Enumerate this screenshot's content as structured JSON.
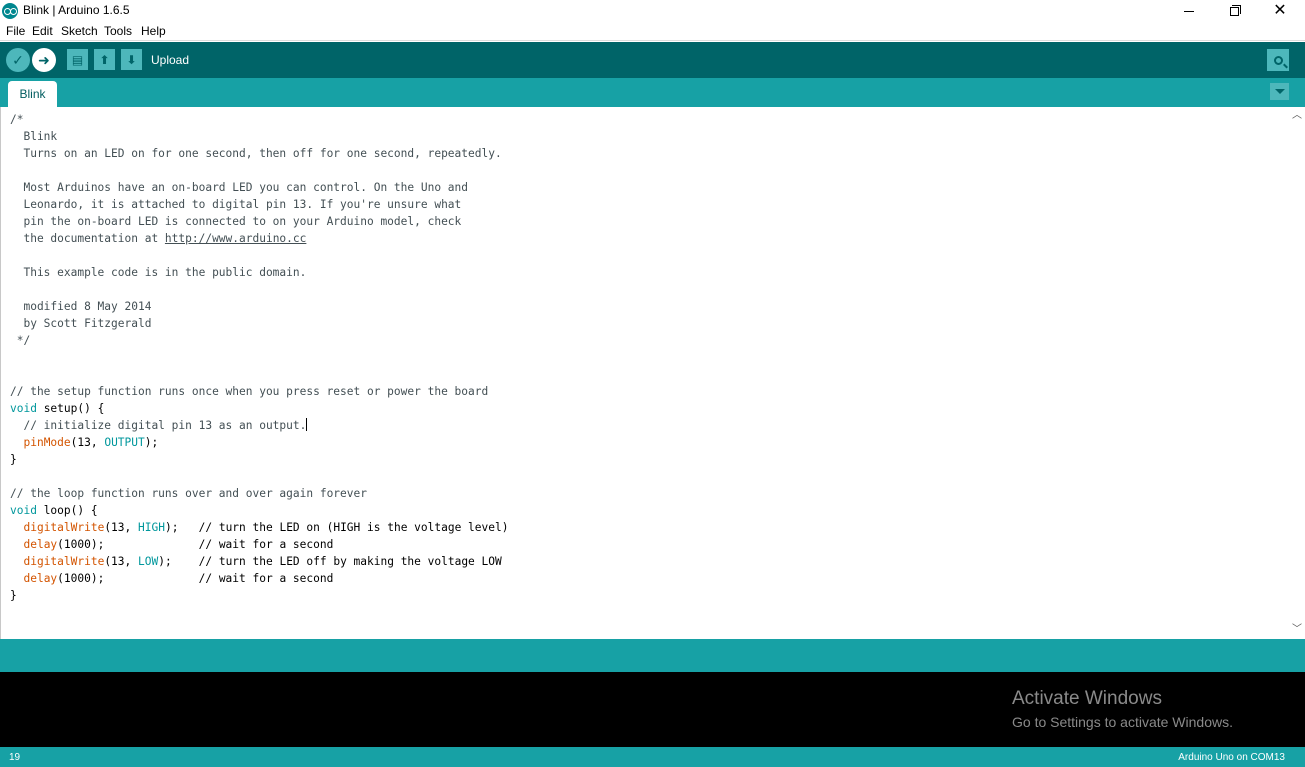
{
  "window": {
    "title": "Blink | Arduino 1.6.5",
    "minimize": "",
    "close": "✕"
  },
  "menu": [
    "File",
    "Edit",
    "Sketch",
    "Tools",
    "Help"
  ],
  "toolbar": {
    "hover_label": "Upload",
    "buttons": [
      {
        "name": "verify",
        "icon": "check-icon",
        "glyph": "✓"
      },
      {
        "name": "upload",
        "icon": "arrow-right-icon",
        "glyph": "➜"
      },
      {
        "name": "new",
        "icon": "new-file-icon",
        "glyph": "▤"
      },
      {
        "name": "open",
        "icon": "arrow-up-icon",
        "glyph": "⬆"
      },
      {
        "name": "save",
        "icon": "arrow-down-icon",
        "glyph": "⬇"
      }
    ]
  },
  "tabs": [
    {
      "label": "Blink",
      "active": true
    }
  ],
  "code": {
    "lines": [
      "/*",
      "  Blink",
      "  Turns on an LED on for one second, then off for one second, repeatedly.",
      "",
      "  Most Arduinos have an on-board LED you can control. On the Uno and",
      "  Leonardo, it is attached to digital pin 13. If you're unsure what",
      "  pin the on-board LED is connected to on your Arduino model, check",
      "  the documentation at ",
      "http://www.arduino.cc",
      "",
      "  This example code is in the public domain.",
      "",
      "  modified 8 May 2014",
      "  by Scott Fitzgerald",
      " */",
      "",
      "",
      "// the setup function runs once when you press reset or power the board",
      "void",
      " setup() {",
      "  // initialize digital pin 13 as an output.",
      "pinMode",
      "(13, ",
      "OUTPUT",
      ");",
      "}",
      "",
      "// the loop function runs over and over again forever",
      "void",
      " loop() {",
      "digitalWrite",
      "(13, ",
      "HIGH",
      ");   // turn the LED on (HIGH is the voltage level)",
      "delay",
      "(1000);              // wait for a second",
      "digitalWrite",
      "(13, ",
      "LOW",
      ");    // turn the LED off by making the voltage LOW",
      "delay",
      "(1000);              // wait for a second",
      "}"
    ]
  },
  "watermark": {
    "title": "Activate Windows",
    "subtitle": "Go to Settings to activate Windows."
  },
  "status": {
    "line": "19",
    "board": "Arduino Uno on COM13"
  },
  "colors": {
    "toolbar": "#006468",
    "tabbar": "#17a1a5",
    "button": "#4db7bb",
    "keyword": "#00979c",
    "function": "#d35400"
  }
}
